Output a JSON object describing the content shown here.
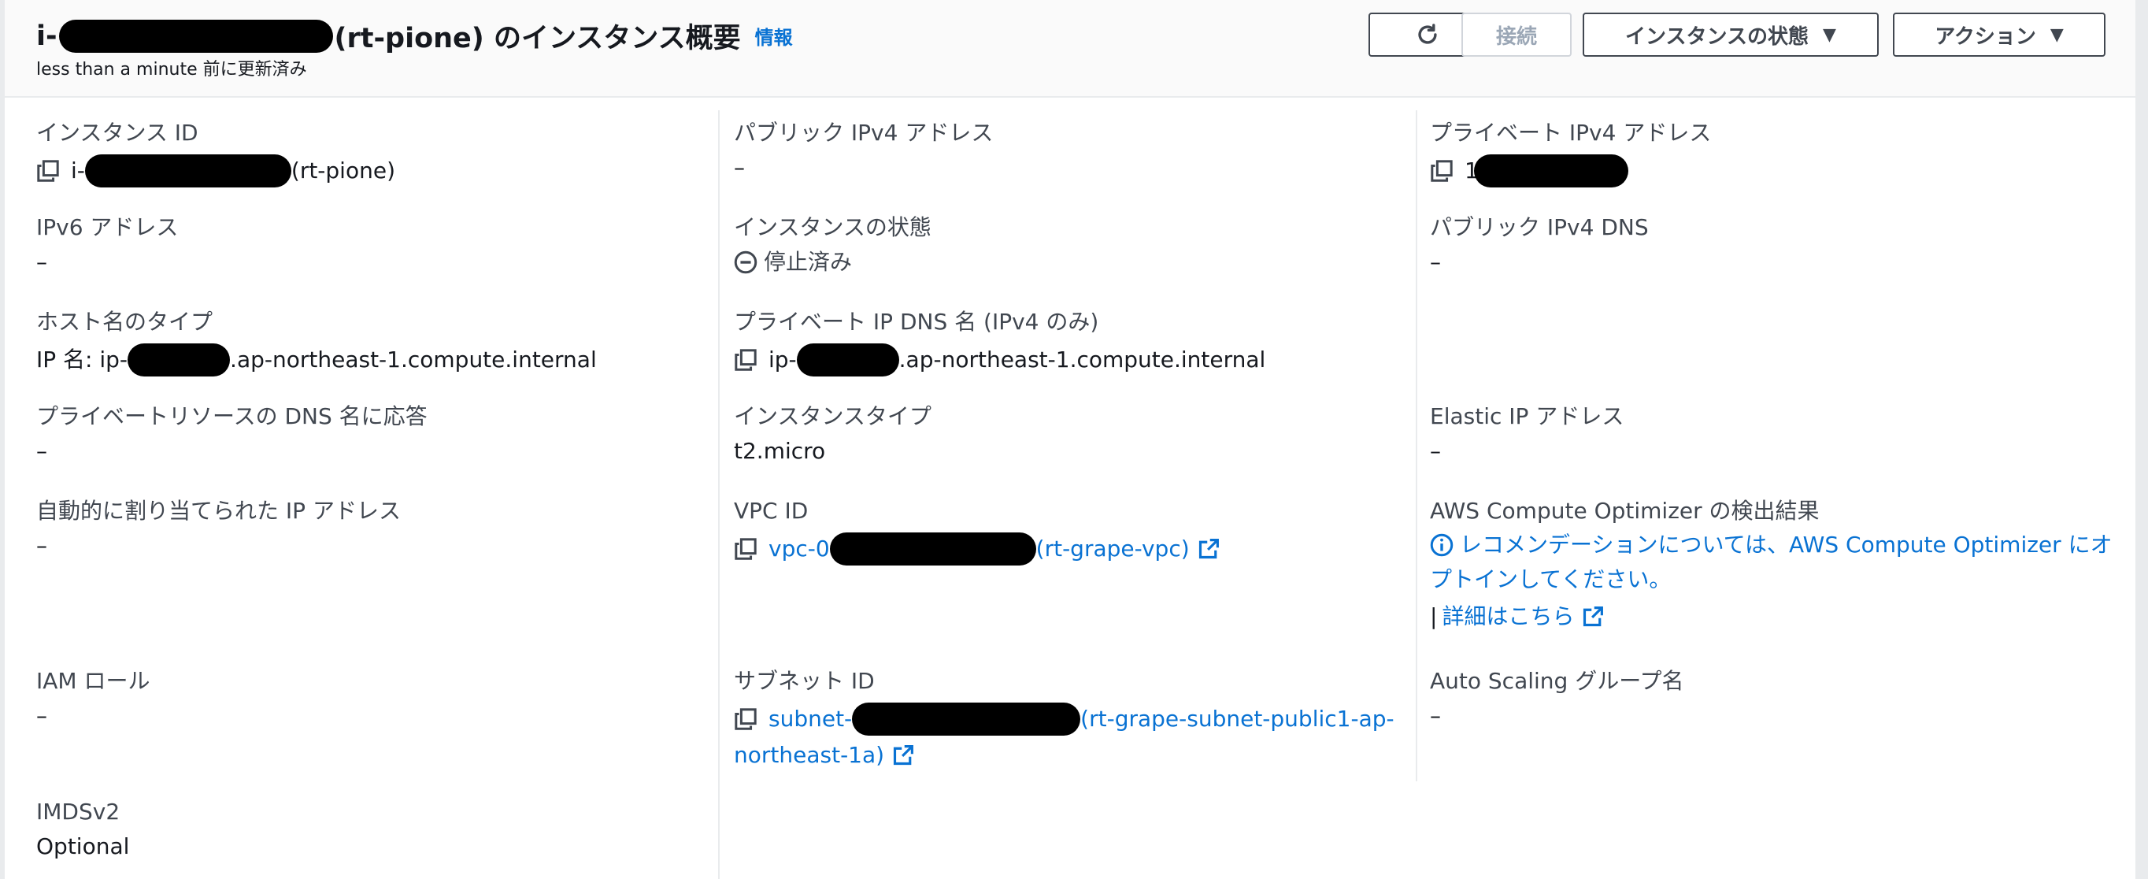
{
  "header": {
    "title_prefix": "i-",
    "title_suffix": "(rt-pione) のインスタンス概要",
    "info_link": "情報",
    "updated": "less than a minute 前に更新済み",
    "buttons": {
      "connect": "接続",
      "instance_state": "インスタンスの状態",
      "actions": "アクション"
    }
  },
  "fields": {
    "instance_id": {
      "label": "インスタンス ID",
      "prefix": "i-",
      "suffix": "(rt-pione)"
    },
    "ipv6": {
      "label": "IPv6 アドレス",
      "value": "–"
    },
    "hostname_type": {
      "label": "ホスト名のタイプ",
      "prefix": "IP 名: ip-",
      "suffix": ".ap-northeast-1.compute.internal"
    },
    "private_dns_answer": {
      "label": "プライベートリソースの DNS 名に応答",
      "value": "–"
    },
    "auto_ip": {
      "label": "自動的に割り当てられた IP アドレス",
      "value": "–"
    },
    "iam_role": {
      "label": "IAM ロール",
      "value": "–"
    },
    "imdsv2": {
      "label": "IMDSv2",
      "value": "Optional"
    },
    "public_ipv4": {
      "label": "パブリック IPv4 アドレス",
      "value": "–"
    },
    "instance_state": {
      "label": "インスタンスの状態",
      "value": "停止済み"
    },
    "private_ip_dns": {
      "label": "プライベート IP DNS 名 (IPv4 のみ)",
      "prefix": "ip-",
      "suffix": ".ap-northeast-1.compute.internal"
    },
    "instance_type": {
      "label": "インスタンスタイプ",
      "value": "t2.micro"
    },
    "vpc_id": {
      "label": "VPC ID",
      "prefix": "vpc-0",
      "suffix": "(rt-grape-vpc)"
    },
    "subnet_id": {
      "label": "サブネット ID",
      "prefix": "subnet-",
      "suffix": "(rt-grape-subnet-public1-ap-",
      "line2": "northeast-1a)"
    },
    "private_ipv4": {
      "label": "プライベート IPv4 アドレス",
      "prefix": "1"
    },
    "public_ipv4_dns": {
      "label": "パブリック IPv4 DNS",
      "value": "–"
    },
    "elastic_ip": {
      "label": "Elastic IP アドレス",
      "value": "–"
    },
    "compute_optimizer": {
      "label": "AWS Compute Optimizer の検出結果",
      "link_line1": "レコメンデーションについては、AWS Compute Optimizer にオ",
      "link_line2": "プトインしてください。",
      "separator": "|",
      "details_link": "詳細はこちら"
    },
    "asg_name": {
      "label": "Auto Scaling グループ名",
      "value": "–"
    }
  }
}
